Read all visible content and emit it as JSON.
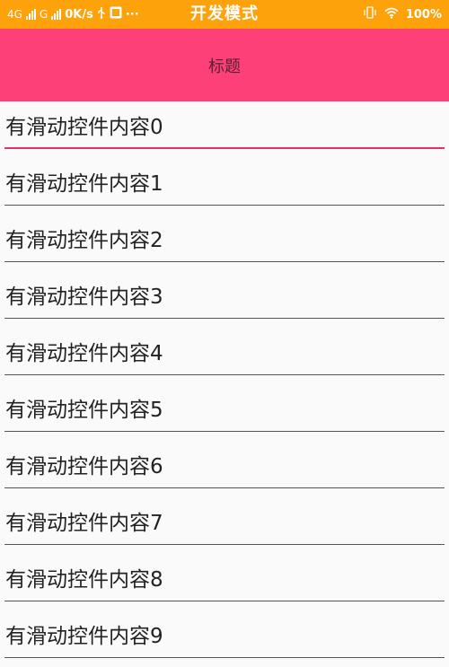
{
  "status_bar": {
    "network1": "4G",
    "network2": "G",
    "speed": "0K/s",
    "usb_icon": "usb-icon",
    "notification_icon": "app-notification-icon",
    "more": "···",
    "mode_title": "开发模式",
    "vibrate_icon": "vibrate-icon",
    "wifi_icon": "wifi-icon",
    "battery": "100%"
  },
  "app_bar": {
    "title": "标题"
  },
  "list": {
    "items": [
      {
        "label": "有滑动控件内容0"
      },
      {
        "label": "有滑动控件内容1"
      },
      {
        "label": "有滑动控件内容2"
      },
      {
        "label": "有滑动控件内容3"
      },
      {
        "label": "有滑动控件内容4"
      },
      {
        "label": "有滑动控件内容5"
      },
      {
        "label": "有滑动控件内容6"
      },
      {
        "label": "有滑动控件内容7"
      },
      {
        "label": "有滑动控件内容8"
      },
      {
        "label": "有滑动控件内容9"
      }
    ]
  },
  "colors": {
    "status_bar_bg": "#fda20b",
    "app_bar_bg": "#fd4078",
    "focus_underline": "#e0336d",
    "page_bg": "#fafafa"
  }
}
